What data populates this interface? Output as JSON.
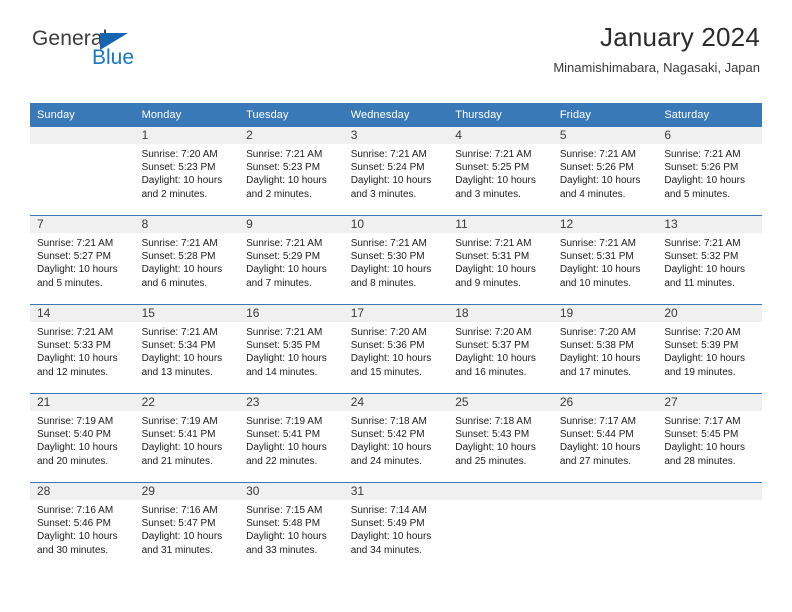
{
  "brand": {
    "name_part1": "General",
    "name_part2": "Blue",
    "triangle_color": "#1565b0",
    "blue_color": "#1976c8"
  },
  "header": {
    "title": "January 2024",
    "subtitle": "Minamishimabara, Nagasaki, Japan"
  },
  "theme": {
    "header_row_bg": "#3a79b8",
    "daynum_band_bg": "#f0f0f0",
    "cell_bg": "#ffffff",
    "text_color": "#1c1c1c"
  },
  "weekday_headers": [
    "Sunday",
    "Monday",
    "Tuesday",
    "Wednesday",
    "Thursday",
    "Friday",
    "Saturday"
  ],
  "weeks": [
    [
      {
        "day": "",
        "sunrise": "",
        "sunset": "",
        "daylight": ""
      },
      {
        "day": "1",
        "sunrise": "Sunrise: 7:20 AM",
        "sunset": "Sunset: 5:23 PM",
        "daylight_l1": "Daylight: 10 hours",
        "daylight_l2": "and 2 minutes."
      },
      {
        "day": "2",
        "sunrise": "Sunrise: 7:21 AM",
        "sunset": "Sunset: 5:23 PM",
        "daylight_l1": "Daylight: 10 hours",
        "daylight_l2": "and 2 minutes."
      },
      {
        "day": "3",
        "sunrise": "Sunrise: 7:21 AM",
        "sunset": "Sunset: 5:24 PM",
        "daylight_l1": "Daylight: 10 hours",
        "daylight_l2": "and 3 minutes."
      },
      {
        "day": "4",
        "sunrise": "Sunrise: 7:21 AM",
        "sunset": "Sunset: 5:25 PM",
        "daylight_l1": "Daylight: 10 hours",
        "daylight_l2": "and 3 minutes."
      },
      {
        "day": "5",
        "sunrise": "Sunrise: 7:21 AM",
        "sunset": "Sunset: 5:26 PM",
        "daylight_l1": "Daylight: 10 hours",
        "daylight_l2": "and 4 minutes."
      },
      {
        "day": "6",
        "sunrise": "Sunrise: 7:21 AM",
        "sunset": "Sunset: 5:26 PM",
        "daylight_l1": "Daylight: 10 hours",
        "daylight_l2": "and 5 minutes."
      }
    ],
    [
      {
        "day": "7",
        "sunrise": "Sunrise: 7:21 AM",
        "sunset": "Sunset: 5:27 PM",
        "daylight_l1": "Daylight: 10 hours",
        "daylight_l2": "and 5 minutes."
      },
      {
        "day": "8",
        "sunrise": "Sunrise: 7:21 AM",
        "sunset": "Sunset: 5:28 PM",
        "daylight_l1": "Daylight: 10 hours",
        "daylight_l2": "and 6 minutes."
      },
      {
        "day": "9",
        "sunrise": "Sunrise: 7:21 AM",
        "sunset": "Sunset: 5:29 PM",
        "daylight_l1": "Daylight: 10 hours",
        "daylight_l2": "and 7 minutes."
      },
      {
        "day": "10",
        "sunrise": "Sunrise: 7:21 AM",
        "sunset": "Sunset: 5:30 PM",
        "daylight_l1": "Daylight: 10 hours",
        "daylight_l2": "and 8 minutes."
      },
      {
        "day": "11",
        "sunrise": "Sunrise: 7:21 AM",
        "sunset": "Sunset: 5:31 PM",
        "daylight_l1": "Daylight: 10 hours",
        "daylight_l2": "and 9 minutes."
      },
      {
        "day": "12",
        "sunrise": "Sunrise: 7:21 AM",
        "sunset": "Sunset: 5:31 PM",
        "daylight_l1": "Daylight: 10 hours",
        "daylight_l2": "and 10 minutes."
      },
      {
        "day": "13",
        "sunrise": "Sunrise: 7:21 AM",
        "sunset": "Sunset: 5:32 PM",
        "daylight_l1": "Daylight: 10 hours",
        "daylight_l2": "and 11 minutes."
      }
    ],
    [
      {
        "day": "14",
        "sunrise": "Sunrise: 7:21 AM",
        "sunset": "Sunset: 5:33 PM",
        "daylight_l1": "Daylight: 10 hours",
        "daylight_l2": "and 12 minutes."
      },
      {
        "day": "15",
        "sunrise": "Sunrise: 7:21 AM",
        "sunset": "Sunset: 5:34 PM",
        "daylight_l1": "Daylight: 10 hours",
        "daylight_l2": "and 13 minutes."
      },
      {
        "day": "16",
        "sunrise": "Sunrise: 7:21 AM",
        "sunset": "Sunset: 5:35 PM",
        "daylight_l1": "Daylight: 10 hours",
        "daylight_l2": "and 14 minutes."
      },
      {
        "day": "17",
        "sunrise": "Sunrise: 7:20 AM",
        "sunset": "Sunset: 5:36 PM",
        "daylight_l1": "Daylight: 10 hours",
        "daylight_l2": "and 15 minutes."
      },
      {
        "day": "18",
        "sunrise": "Sunrise: 7:20 AM",
        "sunset": "Sunset: 5:37 PM",
        "daylight_l1": "Daylight: 10 hours",
        "daylight_l2": "and 16 minutes."
      },
      {
        "day": "19",
        "sunrise": "Sunrise: 7:20 AM",
        "sunset": "Sunset: 5:38 PM",
        "daylight_l1": "Daylight: 10 hours",
        "daylight_l2": "and 17 minutes."
      },
      {
        "day": "20",
        "sunrise": "Sunrise: 7:20 AM",
        "sunset": "Sunset: 5:39 PM",
        "daylight_l1": "Daylight: 10 hours",
        "daylight_l2": "and 19 minutes."
      }
    ],
    [
      {
        "day": "21",
        "sunrise": "Sunrise: 7:19 AM",
        "sunset": "Sunset: 5:40 PM",
        "daylight_l1": "Daylight: 10 hours",
        "daylight_l2": "and 20 minutes."
      },
      {
        "day": "22",
        "sunrise": "Sunrise: 7:19 AM",
        "sunset": "Sunset: 5:41 PM",
        "daylight_l1": "Daylight: 10 hours",
        "daylight_l2": "and 21 minutes."
      },
      {
        "day": "23",
        "sunrise": "Sunrise: 7:19 AM",
        "sunset": "Sunset: 5:41 PM",
        "daylight_l1": "Daylight: 10 hours",
        "daylight_l2": "and 22 minutes."
      },
      {
        "day": "24",
        "sunrise": "Sunrise: 7:18 AM",
        "sunset": "Sunset: 5:42 PM",
        "daylight_l1": "Daylight: 10 hours",
        "daylight_l2": "and 24 minutes."
      },
      {
        "day": "25",
        "sunrise": "Sunrise: 7:18 AM",
        "sunset": "Sunset: 5:43 PM",
        "daylight_l1": "Daylight: 10 hours",
        "daylight_l2": "and 25 minutes."
      },
      {
        "day": "26",
        "sunrise": "Sunrise: 7:17 AM",
        "sunset": "Sunset: 5:44 PM",
        "daylight_l1": "Daylight: 10 hours",
        "daylight_l2": "and 27 minutes."
      },
      {
        "day": "27",
        "sunrise": "Sunrise: 7:17 AM",
        "sunset": "Sunset: 5:45 PM",
        "daylight_l1": "Daylight: 10 hours",
        "daylight_l2": "and 28 minutes."
      }
    ],
    [
      {
        "day": "28",
        "sunrise": "Sunrise: 7:16 AM",
        "sunset": "Sunset: 5:46 PM",
        "daylight_l1": "Daylight: 10 hours",
        "daylight_l2": "and 30 minutes."
      },
      {
        "day": "29",
        "sunrise": "Sunrise: 7:16 AM",
        "sunset": "Sunset: 5:47 PM",
        "daylight_l1": "Daylight: 10 hours",
        "daylight_l2": "and 31 minutes."
      },
      {
        "day": "30",
        "sunrise": "Sunrise: 7:15 AM",
        "sunset": "Sunset: 5:48 PM",
        "daylight_l1": "Daylight: 10 hours",
        "daylight_l2": "and 33 minutes."
      },
      {
        "day": "31",
        "sunrise": "Sunrise: 7:14 AM",
        "sunset": "Sunset: 5:49 PM",
        "daylight_l1": "Daylight: 10 hours",
        "daylight_l2": "and 34 minutes."
      },
      {
        "day": "",
        "sunrise": "",
        "sunset": "",
        "daylight_l1": "",
        "daylight_l2": ""
      },
      {
        "day": "",
        "sunrise": "",
        "sunset": "",
        "daylight_l1": "",
        "daylight_l2": ""
      },
      {
        "day": "",
        "sunrise": "",
        "sunset": "",
        "daylight_l1": "",
        "daylight_l2": ""
      }
    ]
  ]
}
